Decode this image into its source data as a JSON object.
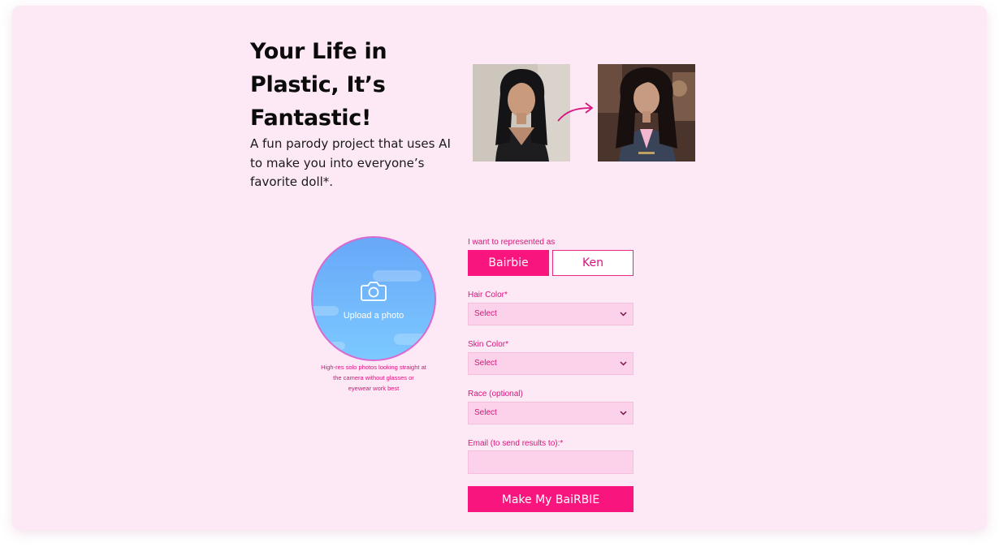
{
  "hero": {
    "title": "Your Life in Plastic, It’s Fantastic!",
    "subtitle": "A fun parody project that uses AI to make you into everyone’s favorite doll*."
  },
  "images": {
    "before": "portrait-photo-of-woman",
    "after": "doll-style-portrait-in-suit",
    "arrow": "curved-arrow-icon"
  },
  "upload": {
    "icon": "camera-icon",
    "label": "Upload a photo",
    "hint": "High-res solo photos looking straight at the camera without glasses or eyewear work best"
  },
  "form": {
    "represent_label": "I want to represented as",
    "options": [
      "Bairbie",
      "Ken"
    ],
    "selected_option": "Bairbie",
    "hair": {
      "label": "Hair Color*",
      "value": "Select"
    },
    "skin": {
      "label": "Skin Color*",
      "value": "Select"
    },
    "race": {
      "label": "Race (optional)",
      "value": "Select"
    },
    "email": {
      "label": "Email (to send results to):*",
      "value": ""
    },
    "submit_label": "Make My BaiRBIE"
  },
  "colors": {
    "background": "#fde8f5",
    "accent": "#f8157e",
    "label": "#d8137d",
    "field": "#fcd2ea"
  }
}
